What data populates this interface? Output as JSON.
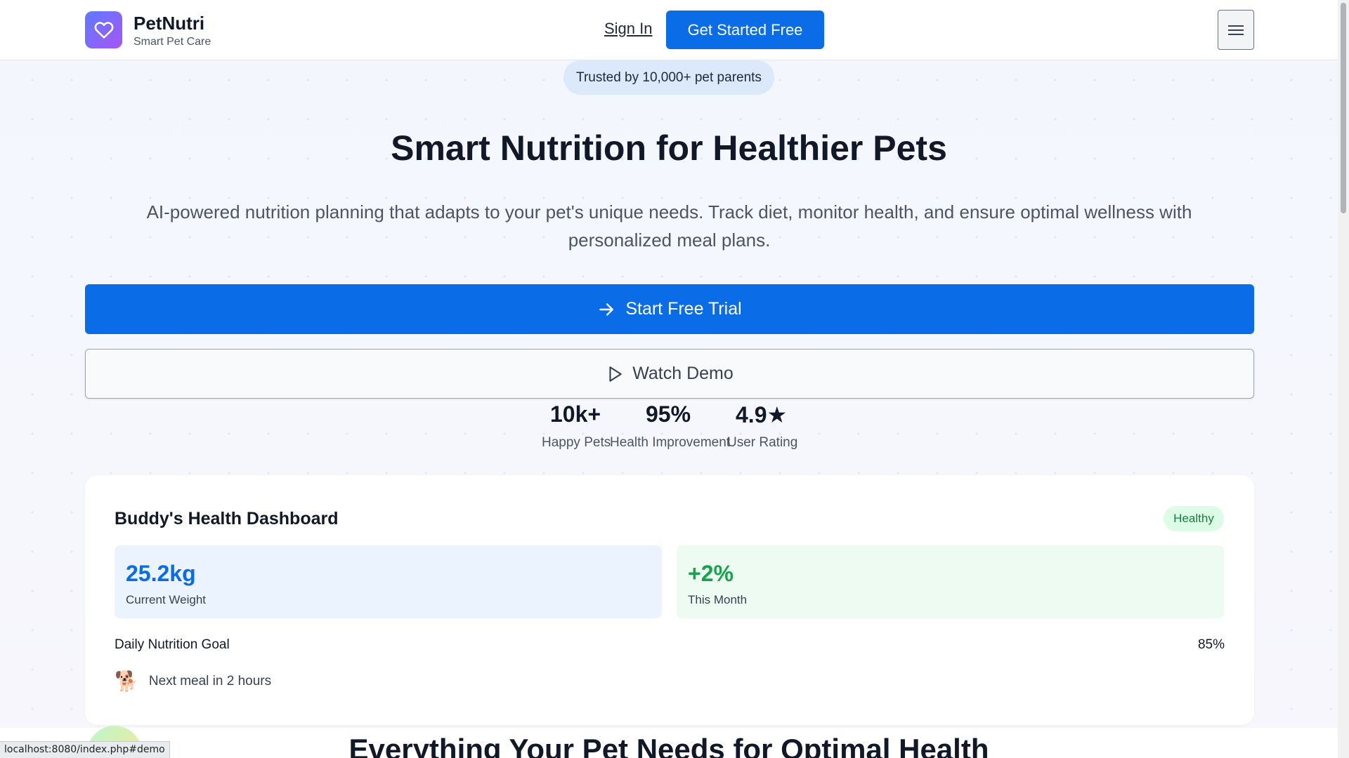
{
  "header": {
    "brand_name": "PetNutri",
    "brand_tagline": "Smart Pet Care",
    "signin_label": "Sign In",
    "cta_label": "Get Started Free",
    "logo_icon": "heart-icon",
    "menu_icon": "hamburger-menu-icon"
  },
  "hero": {
    "trust_badge": "Trusted by 10,000+ pet parents",
    "title": "Smart Nutrition for Healthier Pets",
    "subtitle": "AI-powered nutrition planning that adapts to your pet's unique needs. Track diet, monitor health, and ensure optimal wellness with personalized meal plans.",
    "primary_button": "Start Free Trial",
    "secondary_button": "Watch Demo"
  },
  "stats": [
    {
      "value": "10k+",
      "label": "Happy Pets"
    },
    {
      "value": "95%",
      "label": "Health Improvement"
    },
    {
      "value": "4.9★",
      "label": "User Rating"
    }
  ],
  "dashboard": {
    "title": "Buddy's Health Dashboard",
    "status_badge": "Healthy",
    "weight_value": "25.2kg",
    "weight_label": "Current Weight",
    "change_value": "+2%",
    "change_label": "This Month",
    "nutrition_label": "Daily Nutrition Goal",
    "nutrition_percent": "85%",
    "next_meal_icon": "🐕",
    "next_meal_text": "Next meal in 2 hours"
  },
  "features": {
    "title": "Everything Your Pet Needs for Optimal Health"
  },
  "status_bar": {
    "url": "localhost:8080/index.php#demo"
  },
  "colors": {
    "primary": "#0a6ce6",
    "weight_accent": "#0a6ce6",
    "change_accent": "#16a34a",
    "healthy_badge_bg": "#dcfce7",
    "healthy_badge_text": "#15803d"
  }
}
